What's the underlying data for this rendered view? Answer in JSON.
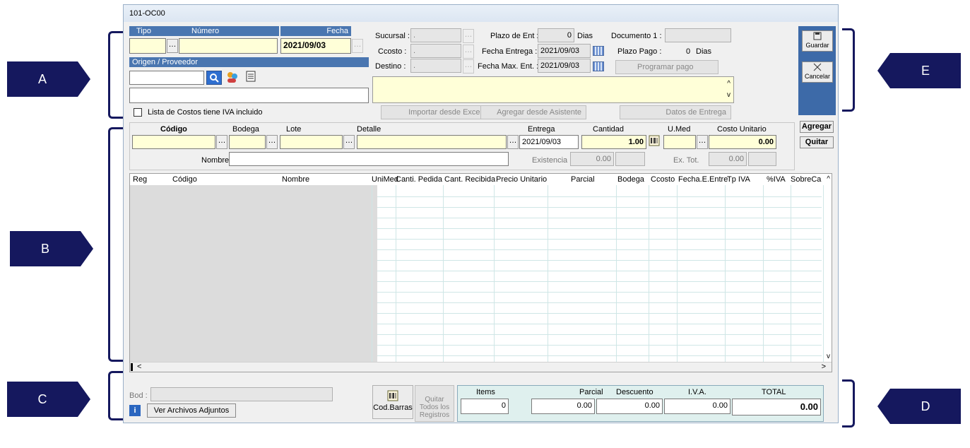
{
  "window_title": "101-OC00",
  "header": {
    "tipo_label": "Tipo",
    "numero_label": "Número",
    "fecha_label": "Fecha",
    "fecha_value": "2021/09/03",
    "origen_label": "Origen / Proveedor",
    "iva_checkbox_label": "Lista de Costos tiene IVA incluido"
  },
  "details": {
    "sucursal_label": "Sucursal :",
    "sucursal_value": ".",
    "ccosto_label": "Ccosto :",
    "ccosto_value": ".",
    "destino_label": "Destino :",
    "destino_value": ".",
    "plazo_ent_label": "Plazo de Ent :",
    "plazo_ent_value": "0",
    "dias1": "Dias",
    "fecha_entrega_label": "Fecha Entrega :",
    "fecha_entrega_value": "2021/09/03",
    "fecha_max_label": "Fecha Max. Ent. :",
    "fecha_max_value": "2021/09/03",
    "documento_label": "Documento 1 :",
    "plazo_pago_label": "Plazo Pago :",
    "plazo_pago_value": "0",
    "dias2": "Dias",
    "programar_pago": "Programar pago",
    "importar_excel": "Importar desde Excel",
    "agregar_asistente": "Agregar desde Asistente",
    "datos_entrega": "Datos de Entrega"
  },
  "side_buttons": {
    "guardar": "Guardar",
    "cancelar": "Cancelar"
  },
  "item_entry": {
    "codigo_label": "Código",
    "bodega_label": "Bodega",
    "lote_label": "Lote",
    "detalle_label": "Detalle",
    "entrega_label": "Entrega",
    "entrega_value": "2021/09/03",
    "cantidad_label": "Cantidad",
    "cantidad_value": "1.00",
    "umed_label": "U.Med",
    "costo_unitario_label": "Costo Unitario",
    "costo_unitario_value": "0.00",
    "nombre_label": "Nombre",
    "existencia_label": "Existencia",
    "existencia_value": "0.00",
    "ex_tot_label": "Ex. Tot.",
    "ex_tot_value": "0.00",
    "agregar": "Agregar",
    "quitar": "Quitar"
  },
  "grid": {
    "columns": [
      "Reg",
      "Código",
      "Nombre",
      "UniMed",
      "Canti. Pedida",
      "Cant. Recibida",
      "Precio Unitario",
      "Parcial",
      "Bodega",
      "Ccosto",
      "Fecha.E.Entre",
      "Tp IVA",
      "%IVA",
      "SobreCa"
    ]
  },
  "footer": {
    "bod_label": "Bod :",
    "ver_archivos": "Ver Archivos Adjuntos",
    "cod_barras": "Cod.Barras",
    "quitar_todos": "Quitar Todos los Registros",
    "items_label": "Items",
    "items_value": "0",
    "parcial_label": "Parcial",
    "parcial_value": "0.00",
    "descuento_label": "Descuento",
    "descuento_value": "0.00",
    "iva_label": "I.V.A.",
    "iva_value": "0.00",
    "total_label": "TOTAL",
    "total_value": "0.00"
  },
  "callouts": {
    "a": "A",
    "b": "B",
    "c": "C",
    "d": "D",
    "e": "E"
  },
  "colors": {
    "callout": "#15185e",
    "header_blue": "#4a76b0",
    "yellow_input": "#ffffd8"
  }
}
